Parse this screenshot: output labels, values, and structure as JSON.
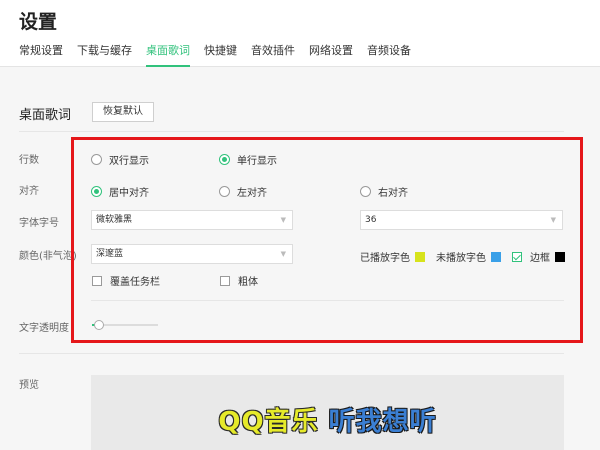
{
  "header": {
    "title": "设置",
    "tabs": [
      "常规设置",
      "下载与缓存",
      "桌面歌词",
      "快捷键",
      "音效插件",
      "网络设置",
      "音频设备"
    ],
    "active_tab": "桌面歌词"
  },
  "section": {
    "title": "桌面歌词",
    "reset_label": "恢复默认"
  },
  "rows": {
    "line_count_label": "行数",
    "double_line": "双行显示",
    "single_line": "单行显示",
    "line_count_selected": "单行显示",
    "align_label": "对齐",
    "align_center": "居中对齐",
    "align_left": "左对齐",
    "align_right": "右对齐",
    "align_selected": "居中对齐",
    "font_label": "字体字号",
    "font_value": "微软雅黑",
    "size_value": "36",
    "color_label": "颜色(非气泡)",
    "color_scheme_value": "深邃蓝",
    "played_color_label": "已播放字色",
    "unplayed_color_label": "未播放字色",
    "border_label": "边框",
    "border_checked": true,
    "cover_taskbar_label": "覆盖任务栏",
    "cover_taskbar_checked": false,
    "bold_label": "粗体",
    "bold_checked": false
  },
  "colors": {
    "played": "#d7e31c",
    "unplayed": "#3aa0e8",
    "border": "#000000",
    "accent": "#31c27c",
    "highlight": "#e5171a"
  },
  "opacity": {
    "label": "文字透明度",
    "value": 0.1
  },
  "preview": {
    "label": "预览",
    "lyric_part1": "QQ音乐",
    "lyric_part2": "听我想听"
  }
}
